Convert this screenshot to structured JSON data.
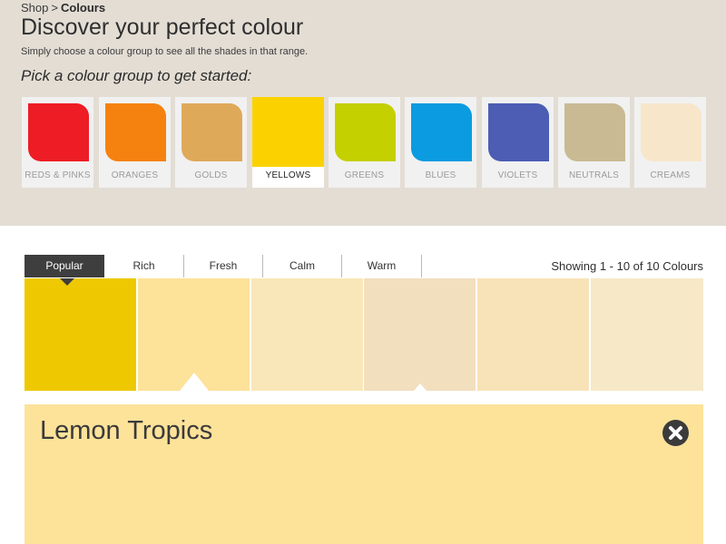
{
  "breadcrumb": {
    "parent": "Shop",
    "separator": ">",
    "current": "Colours"
  },
  "header": {
    "title": "Discover your perfect colour",
    "subtitle": "Simply choose a colour group to see all the shades in that range.",
    "group_heading": "Pick a colour group to get started:"
  },
  "colour_groups": [
    {
      "label": "REDS & PINKS",
      "color": "#ee1c24",
      "selected": false
    },
    {
      "label": "ORANGES",
      "color": "#f5820f",
      "selected": false
    },
    {
      "label": "GOLDS",
      "color": "#dfa95a",
      "selected": false
    },
    {
      "label": "YELLOWS",
      "color": "#fbd200",
      "selected": true
    },
    {
      "label": "GREENS",
      "color": "#c4d000",
      "selected": false
    },
    {
      "label": "BLUES",
      "color": "#0b9be0",
      "selected": false
    },
    {
      "label": "VIOLETS",
      "color": "#4c5db3",
      "selected": false
    },
    {
      "label": "NEUTRALS",
      "color": "#c9ba94",
      "selected": false
    },
    {
      "label": "CREAMS",
      "color": "#f7e6c9",
      "selected": false
    }
  ],
  "mood_tabs": [
    {
      "label": "Popular",
      "active": true
    },
    {
      "label": "Rich",
      "active": false
    },
    {
      "label": "Fresh",
      "active": false
    },
    {
      "label": "Calm",
      "active": false
    },
    {
      "label": "Warm",
      "active": false
    }
  ],
  "showing_text": "Showing 1 - 10 of 10 Colours",
  "shades": [
    {
      "color": "#eec902"
    },
    {
      "color": "#fde29a"
    },
    {
      "color": "#f9e7b9"
    },
    {
      "color": "#f2dfbe"
    },
    {
      "color": "#f8e3b8"
    },
    {
      "color": "#f7e9c8"
    }
  ],
  "detail": {
    "name": "Lemon Tropics",
    "color": "#fde29a",
    "close_icon": "close-circle-icon"
  }
}
